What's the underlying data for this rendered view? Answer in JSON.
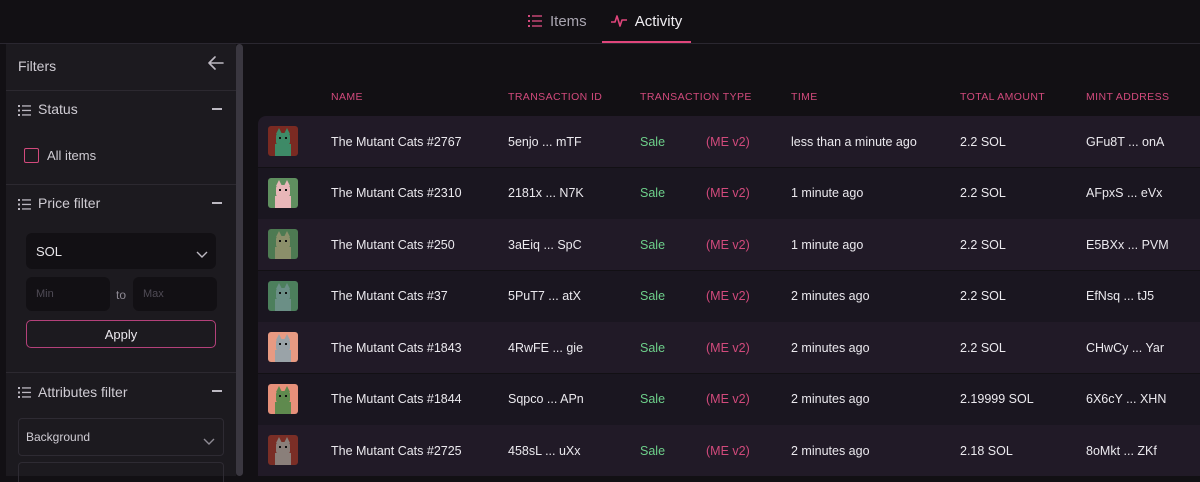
{
  "tabs": [
    {
      "label": "Items",
      "icon": "list-icon"
    },
    {
      "label": "Activity",
      "icon": "activity-icon",
      "active": true
    }
  ],
  "sidebar": {
    "title": "Filters",
    "back_icon": "arrow-left-icon",
    "status": {
      "label": "Status",
      "checkbox_label": "All items",
      "checked": false
    },
    "price": {
      "label": "Price filter",
      "currency": "SOL",
      "min_placeholder": "Min",
      "max_placeholder": "Max",
      "to_label": "to",
      "apply_label": "Apply"
    },
    "attributes": {
      "label": "Attributes filter",
      "first_select": "Background"
    }
  },
  "table": {
    "headers": [
      "NAME",
      "TRANSACTION ID",
      "TRANSACTION TYPE",
      "TIME",
      "TOTAL AMOUNT",
      "MINT ADDRESS"
    ],
    "rows": [
      {
        "name": "The Mutant Cats #2767",
        "tx": "5enjo ... mTF",
        "type": "Sale",
        "market": "(ME v2)",
        "time": "less than a minute ago",
        "amount": "2.2 SOL",
        "mint": "GFu8T ... onA",
        "bg": "#7a2a22",
        "cat": "#3e8a67"
      },
      {
        "name": "The Mutant Cats #2310",
        "tx": "2181x ... N7K",
        "type": "Sale",
        "market": "(ME v2)",
        "time": "1 minute ago",
        "amount": "2.2 SOL",
        "mint": "AFpxS ... eVx",
        "bg": "#5f8f5f",
        "cat": "#e8b6b8"
      },
      {
        "name": "The Mutant Cats #250",
        "tx": "3aEiq ... SpC",
        "type": "Sale",
        "market": "(ME v2)",
        "time": "1 minute ago",
        "amount": "2.2 SOL",
        "mint": "E5BXx ... PVM",
        "bg": "#4d7a52",
        "cat": "#8b8f6a"
      },
      {
        "name": "The Mutant Cats #37",
        "tx": "5PuT7 ... atX",
        "type": "Sale",
        "market": "(ME v2)",
        "time": "2 minutes ago",
        "amount": "2.2 SOL",
        "mint": "EfNsq ... tJ5",
        "bg": "#4c7f5c",
        "cat": "#6b8f86"
      },
      {
        "name": "The Mutant Cats #1843",
        "tx": "4RwFE ... gie",
        "type": "Sale",
        "market": "(ME v2)",
        "time": "2 minutes ago",
        "amount": "2.2 SOL",
        "mint": "CHwCy ... Yar",
        "bg": "#e89a82",
        "cat": "#9aa3a8"
      },
      {
        "name": "The Mutant Cats #1844",
        "tx": "Sqpco ... APn",
        "type": "Sale",
        "market": "(ME v2)",
        "time": "2 minutes ago",
        "amount": "2.19999 SOL",
        "mint": "6X6cY ... XHN",
        "bg": "#e6907a",
        "cat": "#5f8a4e"
      },
      {
        "name": "The Mutant Cats #2725",
        "tx": "458sL ... uXx",
        "type": "Sale",
        "market": "(ME v2)",
        "time": "2 minutes ago",
        "amount": "2.18 SOL",
        "mint": "8oMkt ... ZKf",
        "bg": "#7a2e26",
        "cat": "#8a7f7a"
      }
    ]
  },
  "colors": {
    "accent": "#e0457b",
    "sale": "#6dcf8a",
    "market": "#d24a7c"
  }
}
